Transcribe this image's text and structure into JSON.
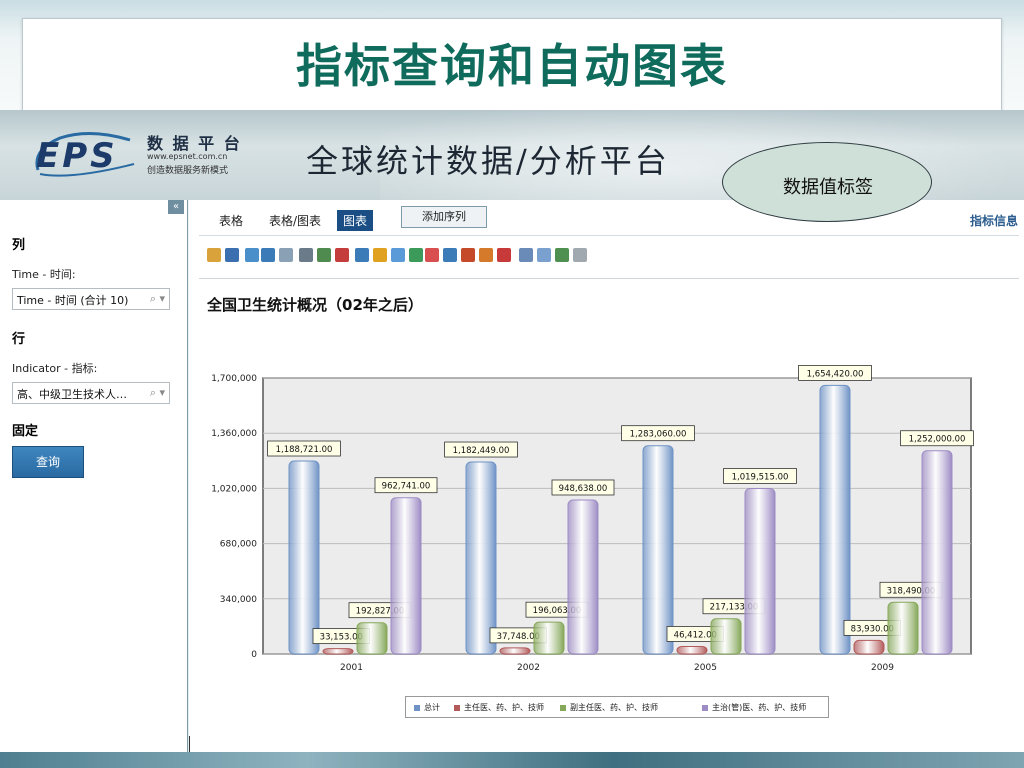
{
  "slide": {
    "title": "指标查询和自动图表"
  },
  "banner": {
    "logo": "EPS",
    "sub1": "数 据 平 台",
    "sub2": "www.epsnet.com.cn",
    "sub3": "创造数据服务新模式",
    "title": "全球统计数据/分析平台"
  },
  "callout": {
    "text": "数据值标签"
  },
  "left_panel": {
    "collapse_icon": "double-chevron-left-icon",
    "collapse_glyph": "«",
    "column_heading": "列",
    "column_label": "Time - 时间:",
    "column_select": "Time - 时间 (合计 10)",
    "row_heading": "行",
    "row_label": "Indicator - 指标:",
    "row_select": "高、中级卫生技术人…",
    "fixed_heading": "固定",
    "query_button": "查询"
  },
  "tabs": {
    "table": "表格",
    "table_chart": "表格/图表",
    "chart": "图表",
    "add_series": "添加序列",
    "indicator_info": "指标信息",
    "active": "chart"
  },
  "toolbar_icons": [
    "export-icon",
    "save-icon",
    "refresh-icon",
    "undo-icon",
    "redo-icon",
    "print-icon",
    "copy-icon",
    "pdf-icon",
    "line-chart-icon",
    "bar-chart-icon",
    "horizontal-bar-icon",
    "column-chart-icon",
    "stacked-bar-icon",
    "area-chart-icon",
    "pie-chart-icon",
    "radar-icon",
    "scatter-icon",
    "trend-icon",
    "smooth-line-icon",
    "grid-icon",
    "settings-icon"
  ],
  "chart_title": "全国卫生统计概况（02年之后）",
  "chart_data": {
    "type": "bar",
    "categories": [
      "2001",
      "2002",
      "2005",
      "2009"
    ],
    "series": [
      {
        "name": "总计",
        "values": [
          1188721,
          1182449,
          1283060,
          1654420
        ],
        "labels": [
          "1,188,721.00",
          "1,182,449.00",
          "1,283,060.00",
          "1,654,420.00"
        ],
        "color": "#6f93c6"
      },
      {
        "name": "主任医、药、护、技师",
        "values": [
          33153,
          37748,
          46412,
          83930
        ],
        "labels": [
          "33,153.00",
          "37,748.00",
          "46,412.00",
          "83,930.00"
        ],
        "color": "#b35a5a"
      },
      {
        "name": "副主任医、药、护、技师",
        "values": [
          192827,
          196063,
          217133,
          318490
        ],
        "labels": [
          "192,827.00",
          "196,063.00",
          "217,133.00",
          "318,490.00"
        ],
        "color": "#86a85a"
      },
      {
        "name": "主治(管)医、药、护、技师",
        "values": [
          962741,
          948638,
          1019515,
          1252000
        ],
        "labels": [
          "962,741.00",
          "948,638.00",
          "1,019,515.00",
          "1,252,000.00"
        ],
        "color": "#9d8cc4"
      }
    ],
    "y_ticks": [
      "1,700,000",
      "1,360,000",
      "1,020,000",
      "680,000",
      "340,000",
      "0"
    ],
    "ylim": [
      0,
      1700000
    ],
    "grid": true,
    "legend_position": "bottom"
  }
}
